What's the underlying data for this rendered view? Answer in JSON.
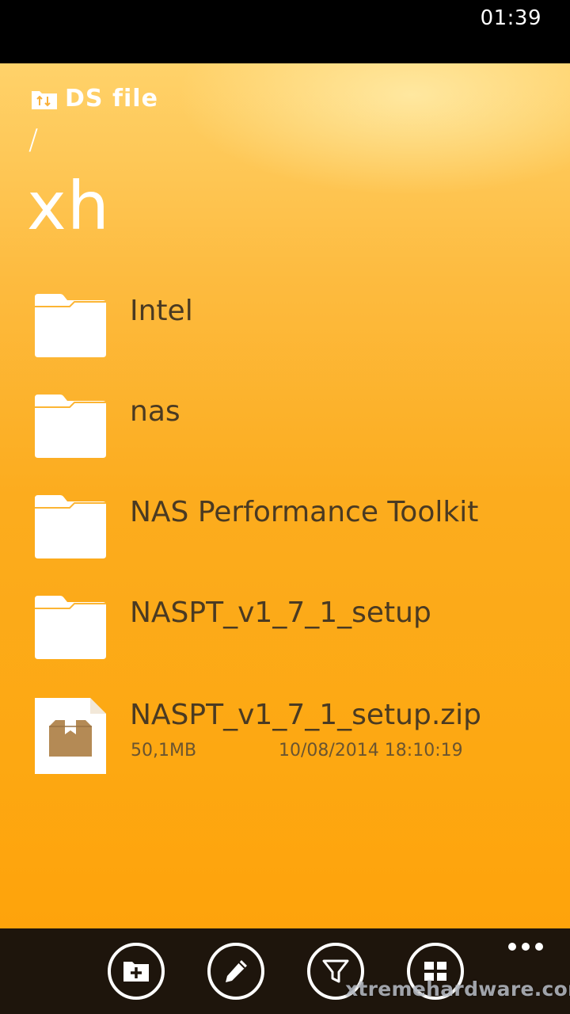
{
  "status": {
    "time": "01:39"
  },
  "app": {
    "logo_text": "DS file"
  },
  "path": {
    "separator": "/",
    "title": "xh"
  },
  "items": [
    {
      "type": "folder",
      "name": "Intel"
    },
    {
      "type": "folder",
      "name": "nas"
    },
    {
      "type": "folder",
      "name": "NAS Performance Toolkit"
    },
    {
      "type": "folder",
      "name": "NASPT_v1_7_1_setup"
    },
    {
      "type": "file",
      "name": "NASPT_v1_7_1_setup.zip",
      "size": "50,1MB",
      "date": "10/08/2014 18:10:19"
    }
  ],
  "app_bar": {
    "buttons": [
      "add-folder-icon",
      "edit-icon",
      "filter-icon",
      "view-grid-icon"
    ]
  },
  "watermark": {
    "text": "xtremehardware.com"
  },
  "colors": {
    "accent": "#fcac1e",
    "text_dark": "#4a3a22",
    "app_bar": "#1e150c"
  }
}
